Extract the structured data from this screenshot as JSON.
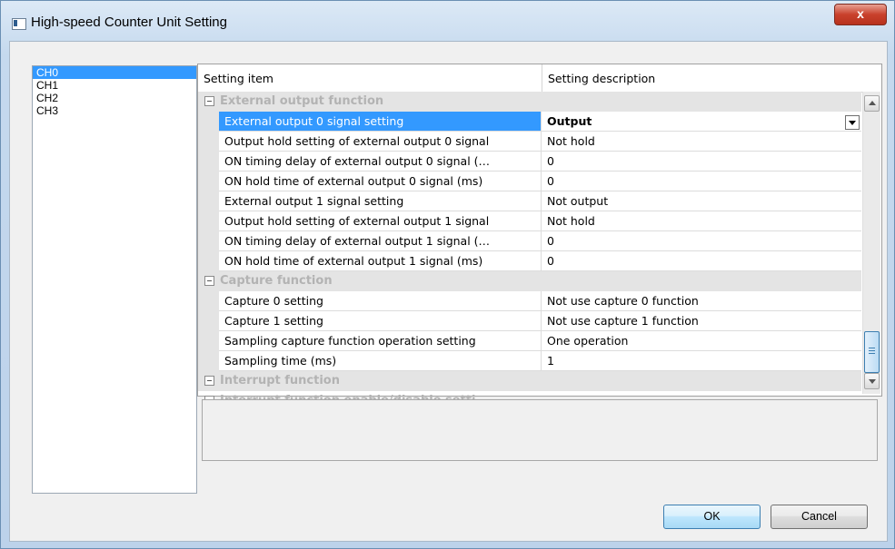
{
  "window": {
    "title": "High-speed Counter Unit Setting",
    "close_glyph": "x"
  },
  "channels": [
    "CH0",
    "CH1",
    "CH2",
    "CH3"
  ],
  "selected_channel": "CH0",
  "grid": {
    "columns": [
      "Setting item",
      "Setting description"
    ],
    "rows": [
      {
        "type": "category",
        "label": "External output function"
      },
      {
        "type": "item",
        "name": "External output 0 signal setting",
        "value": "Output",
        "selected": true,
        "dropdown": true
      },
      {
        "type": "item",
        "name": "Output hold setting of external output 0 signal",
        "value": "Not hold"
      },
      {
        "type": "item",
        "name": "ON timing delay of external output 0 signal (…",
        "value": "0"
      },
      {
        "type": "item",
        "name": "ON hold time of external output 0 signal (ms)",
        "value": "0"
      },
      {
        "type": "item",
        "name": "External output 1 signal setting",
        "value": "Not output"
      },
      {
        "type": "item",
        "name": "Output hold setting of external output 1 signal",
        "value": "Not hold"
      },
      {
        "type": "item",
        "name": "ON timing delay of external output 1 signal (…",
        "value": "0"
      },
      {
        "type": "item",
        "name": "ON hold time of external output 1 signal (ms)",
        "value": "0"
      },
      {
        "type": "category",
        "label": "Capture function"
      },
      {
        "type": "item",
        "name": "Capture 0 setting",
        "value": "Not use capture 0 function"
      },
      {
        "type": "item",
        "name": "Capture 1 setting",
        "value": "Not use capture 1 function"
      },
      {
        "type": "item",
        "name": "Sampling capture function operation setting",
        "value": "One operation"
      },
      {
        "type": "item",
        "name": "Sampling time (ms)",
        "value": "1"
      },
      {
        "type": "category",
        "label": "Interrupt function"
      },
      {
        "type": "subcategory",
        "label": "Interrupt function enable/disable setti"
      }
    ]
  },
  "description_text": "",
  "buttons": {
    "ok": "OK",
    "cancel": "Cancel"
  }
}
